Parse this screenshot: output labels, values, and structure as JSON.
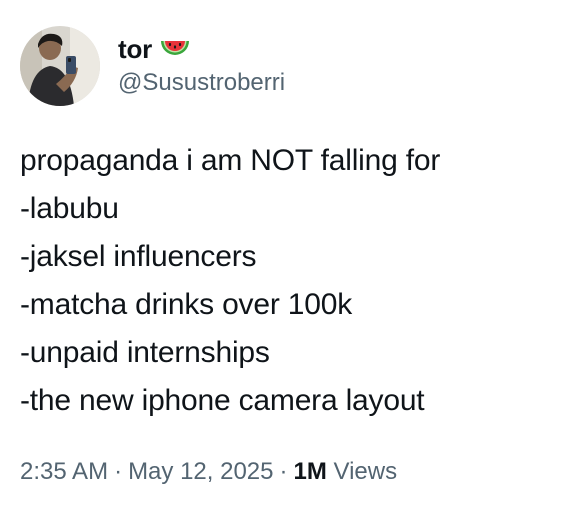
{
  "author": {
    "display_name": "tor",
    "name_emoji": "watermelon-emoji",
    "handle": "@Susustroberri"
  },
  "tweet": {
    "lines": [
      "propaganda i am NOT falling for",
      "-labubu",
      "-jaksel influencers",
      "-matcha drinks over 100k",
      "-unpaid internships",
      "-the new iphone camera layout"
    ]
  },
  "meta": {
    "time": "2:35 AM",
    "separator": "·",
    "date": "May 12, 2025",
    "views_count": "1M",
    "views_label": "Views"
  },
  "colors": {
    "text_primary": "#0f1419",
    "text_secondary": "#536471"
  }
}
